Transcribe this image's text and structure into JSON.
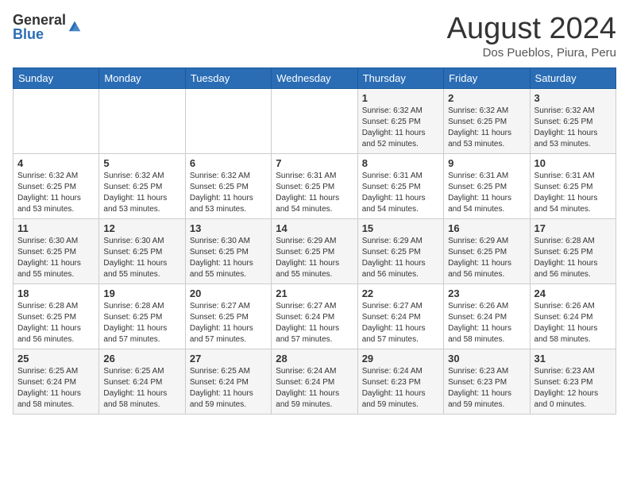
{
  "header": {
    "logo_general": "General",
    "logo_blue": "Blue",
    "month_year": "August 2024",
    "subtitle": "Dos Pueblos, Piura, Peru"
  },
  "days_of_week": [
    "Sunday",
    "Monday",
    "Tuesday",
    "Wednesday",
    "Thursday",
    "Friday",
    "Saturday"
  ],
  "weeks": [
    [
      {
        "day": "",
        "info": ""
      },
      {
        "day": "",
        "info": ""
      },
      {
        "day": "",
        "info": ""
      },
      {
        "day": "",
        "info": ""
      },
      {
        "day": "1",
        "info": "Sunrise: 6:32 AM\nSunset: 6:25 PM\nDaylight: 11 hours\nand 52 minutes."
      },
      {
        "day": "2",
        "info": "Sunrise: 6:32 AM\nSunset: 6:25 PM\nDaylight: 11 hours\nand 53 minutes."
      },
      {
        "day": "3",
        "info": "Sunrise: 6:32 AM\nSunset: 6:25 PM\nDaylight: 11 hours\nand 53 minutes."
      }
    ],
    [
      {
        "day": "4",
        "info": "Sunrise: 6:32 AM\nSunset: 6:25 PM\nDaylight: 11 hours\nand 53 minutes."
      },
      {
        "day": "5",
        "info": "Sunrise: 6:32 AM\nSunset: 6:25 PM\nDaylight: 11 hours\nand 53 minutes."
      },
      {
        "day": "6",
        "info": "Sunrise: 6:32 AM\nSunset: 6:25 PM\nDaylight: 11 hours\nand 53 minutes."
      },
      {
        "day": "7",
        "info": "Sunrise: 6:31 AM\nSunset: 6:25 PM\nDaylight: 11 hours\nand 54 minutes."
      },
      {
        "day": "8",
        "info": "Sunrise: 6:31 AM\nSunset: 6:25 PM\nDaylight: 11 hours\nand 54 minutes."
      },
      {
        "day": "9",
        "info": "Sunrise: 6:31 AM\nSunset: 6:25 PM\nDaylight: 11 hours\nand 54 minutes."
      },
      {
        "day": "10",
        "info": "Sunrise: 6:31 AM\nSunset: 6:25 PM\nDaylight: 11 hours\nand 54 minutes."
      }
    ],
    [
      {
        "day": "11",
        "info": "Sunrise: 6:30 AM\nSunset: 6:25 PM\nDaylight: 11 hours\nand 55 minutes."
      },
      {
        "day": "12",
        "info": "Sunrise: 6:30 AM\nSunset: 6:25 PM\nDaylight: 11 hours\nand 55 minutes."
      },
      {
        "day": "13",
        "info": "Sunrise: 6:30 AM\nSunset: 6:25 PM\nDaylight: 11 hours\nand 55 minutes."
      },
      {
        "day": "14",
        "info": "Sunrise: 6:29 AM\nSunset: 6:25 PM\nDaylight: 11 hours\nand 55 minutes."
      },
      {
        "day": "15",
        "info": "Sunrise: 6:29 AM\nSunset: 6:25 PM\nDaylight: 11 hours\nand 56 minutes."
      },
      {
        "day": "16",
        "info": "Sunrise: 6:29 AM\nSunset: 6:25 PM\nDaylight: 11 hours\nand 56 minutes."
      },
      {
        "day": "17",
        "info": "Sunrise: 6:28 AM\nSunset: 6:25 PM\nDaylight: 11 hours\nand 56 minutes."
      }
    ],
    [
      {
        "day": "18",
        "info": "Sunrise: 6:28 AM\nSunset: 6:25 PM\nDaylight: 11 hours\nand 56 minutes."
      },
      {
        "day": "19",
        "info": "Sunrise: 6:28 AM\nSunset: 6:25 PM\nDaylight: 11 hours\nand 57 minutes."
      },
      {
        "day": "20",
        "info": "Sunrise: 6:27 AM\nSunset: 6:25 PM\nDaylight: 11 hours\nand 57 minutes."
      },
      {
        "day": "21",
        "info": "Sunrise: 6:27 AM\nSunset: 6:24 PM\nDaylight: 11 hours\nand 57 minutes."
      },
      {
        "day": "22",
        "info": "Sunrise: 6:27 AM\nSunset: 6:24 PM\nDaylight: 11 hours\nand 57 minutes."
      },
      {
        "day": "23",
        "info": "Sunrise: 6:26 AM\nSunset: 6:24 PM\nDaylight: 11 hours\nand 58 minutes."
      },
      {
        "day": "24",
        "info": "Sunrise: 6:26 AM\nSunset: 6:24 PM\nDaylight: 11 hours\nand 58 minutes."
      }
    ],
    [
      {
        "day": "25",
        "info": "Sunrise: 6:25 AM\nSunset: 6:24 PM\nDaylight: 11 hours\nand 58 minutes."
      },
      {
        "day": "26",
        "info": "Sunrise: 6:25 AM\nSunset: 6:24 PM\nDaylight: 11 hours\nand 58 minutes."
      },
      {
        "day": "27",
        "info": "Sunrise: 6:25 AM\nSunset: 6:24 PM\nDaylight: 11 hours\nand 59 minutes."
      },
      {
        "day": "28",
        "info": "Sunrise: 6:24 AM\nSunset: 6:24 PM\nDaylight: 11 hours\nand 59 minutes."
      },
      {
        "day": "29",
        "info": "Sunrise: 6:24 AM\nSunset: 6:23 PM\nDaylight: 11 hours\nand 59 minutes."
      },
      {
        "day": "30",
        "info": "Sunrise: 6:23 AM\nSunset: 6:23 PM\nDaylight: 11 hours\nand 59 minutes."
      },
      {
        "day": "31",
        "info": "Sunrise: 6:23 AM\nSunset: 6:23 PM\nDaylight: 12 hours\nand 0 minutes."
      }
    ]
  ]
}
